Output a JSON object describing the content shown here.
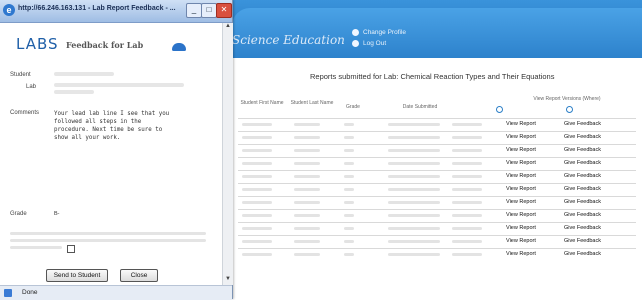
{
  "window": {
    "title": "http://66.246.163.131 - Lab Report Feedback - ...",
    "status": "Done"
  },
  "popup": {
    "logo": "LABS",
    "heading": "Feedback for Lab",
    "student_label": "Student",
    "lab_label": "Lab",
    "comments_label": "Comments",
    "comments_value": "Your lead lab line I see that you\nfollowed all steps in the\nprocedure. Next time be sure to\nshow all your work.",
    "grade_label": "Grade",
    "grade_value": "B-",
    "send_button": "Send to Student",
    "close_button": "Close"
  },
  "page": {
    "reports_title": "Reports submitted for Lab: Chemical Reaction Types and Their Equations",
    "nav": {
      "item1": "Change Profile",
      "item2": "Log Out"
    },
    "columns": [
      "Student First Name",
      "Student Last Name",
      "Grade",
      "Date Submitted"
    ],
    "actions_header": "View Report Versions (Where)",
    "rows": [
      {
        "view": "View Report",
        "give": "Give Feedback"
      },
      {
        "view": "View Report",
        "give": "Give Feedback"
      },
      {
        "view": "View Report",
        "give": "Give Feedback"
      },
      {
        "view": "View Report",
        "give": "Give Feedback"
      },
      {
        "view": "View Report",
        "give": "Give Feedback"
      },
      {
        "view": "View Report",
        "give": "Give Feedback"
      },
      {
        "view": "View Report",
        "give": "Give Feedback"
      },
      {
        "view": "View Report",
        "give": "Give Feedback"
      },
      {
        "view": "View Report",
        "give": "Give Feedback"
      },
      {
        "view": "View Report",
        "give": "Give Feedback"
      },
      {
        "view": "View Report",
        "give": "Give Feedback"
      }
    ]
  },
  "colors": {
    "banner": "#2b7fc7",
    "popup_title": "#9fbde4",
    "logo": "#1f5fa8"
  },
  "icons": [
    "internet-explorer-icon",
    "minimize-icon",
    "maximize-icon",
    "close-icon",
    "page-icon"
  ]
}
